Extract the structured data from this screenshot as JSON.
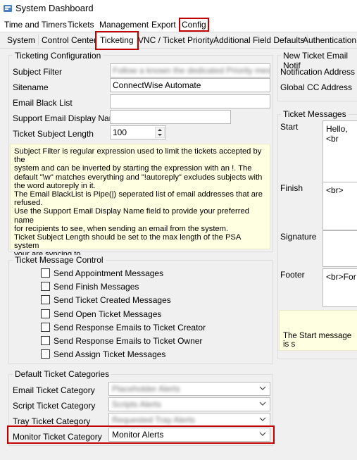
{
  "window": {
    "title": "System Dashboard"
  },
  "menu": {
    "items": [
      "Time and Timers",
      "Tickets",
      "Management",
      "Export",
      "Config"
    ]
  },
  "tabs": [
    "System",
    "Control Center",
    "Ticketing",
    "VNC / Ticket Priority",
    "Additional Field Defaults",
    "Authentication"
  ],
  "ticket_config": {
    "title": "Ticketing Configuration",
    "subject_filter_label": "Subject Filter",
    "subject_filter_value": "Follow a known the dedicated Priority message from",
    "sitename_label": "Sitename",
    "sitename_value": "ConnectWise Automate",
    "blacklist_label": "Email Black List",
    "support_name_label": "Support Email Display Name",
    "subject_length_label": "Ticket Subject Length",
    "subject_length_value": "100",
    "help_lines": [
      "Subject Filter is regular expression used to limit the tickets accepted by the",
      "system and can be inverted by starting the expression with an !. The",
      "default \"\\w\" matches everything and \"!autoreply\" excludes subjects with",
      "the word autoreply in it.",
      "The Email BlackList is Pipe(|) seperated list of email addresses that are",
      "refused.",
      "Use the Support Email Display Name field to provide your preferred name",
      "for recipients to see, when sending an email from the system.",
      "Ticket Subject Length should be set to the max length of the PSA system",
      "your are syncing to."
    ]
  },
  "message_control": {
    "title": "Ticket Message Control",
    "options": [
      "Send Appointment Messages",
      "Send Finish Messages",
      "Send Ticket Created Messages",
      "Send Open Ticket Messages",
      "Send Response Emails to Ticket Creator",
      "Send Response Emails to Ticket Owner",
      "Send Assign Ticket Messages"
    ]
  },
  "categories": {
    "title": "Default Ticket Categories",
    "email_label": "Email Ticket Category",
    "email_value": "Placeholder Alerts",
    "script_label": "Script Ticket Category",
    "script_value": "Scripts Alerts",
    "tray_label": "Tray Ticket Category",
    "tray_value": "Requested Tray Alerts",
    "monitor_label": "Monitor Ticket Category",
    "monitor_value": "Monitor Alerts"
  },
  "notify": {
    "title": "New Ticket Email Notif",
    "address_label": "Notification Address",
    "cc_label": "Global CC Address"
  },
  "messages": {
    "title": "Ticket Messages",
    "start_label": "Start",
    "start_value": "Hello,<br",
    "finish_label": "Finish",
    "finish_value": "<br>",
    "signature_label": "Signature",
    "footer_label": "Footer",
    "footer_value": "<br>For",
    "info": "The Start message is s"
  }
}
